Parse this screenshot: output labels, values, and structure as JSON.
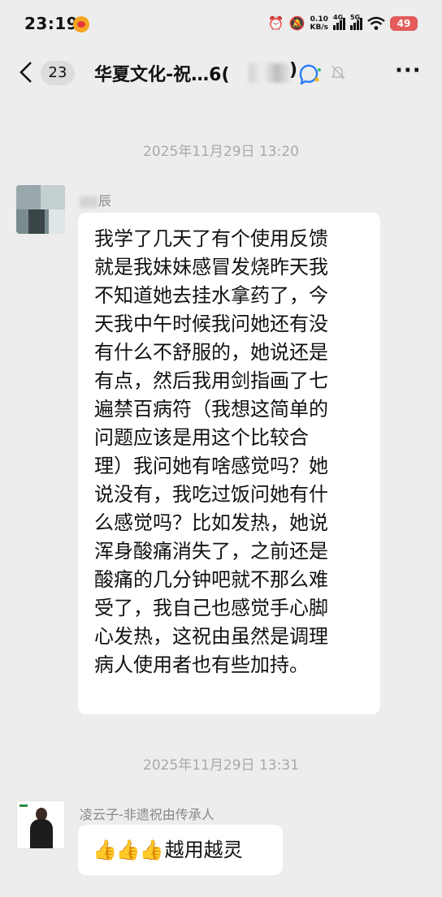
{
  "status_bar": {
    "time": "23:19",
    "net_speed_value": "0.10",
    "net_speed_unit": "KB/s",
    "signal_1_tag": "4G",
    "signal_2_tag": "5G",
    "battery": "49",
    "icons": [
      "weibo-icon",
      "alarm-icon",
      "mute-icon",
      "wifi-icon",
      "battery-icon"
    ]
  },
  "title_bar": {
    "back_icon": "chevron-left-icon",
    "unread_count": "23",
    "title": "华夏文化-祝…6(",
    "title_tail": ")",
    "icons": [
      "ai-assistant-icon",
      "bell-muted-icon",
      "more-icon"
    ],
    "more": "···"
  },
  "messages": [
    {
      "timestamp": "2025年11月29日 13:20",
      "sender": "辰",
      "lines": [
        "我学了几天了有个使用反馈",
        "就是我妹妹感冒发烧昨天我",
        "不知道她去挂水拿药了，今",
        "天我中午时候我问她还有没",
        "有什么不舒服的，她说还是",
        "有点，然后我用剑指画了七",
        "遍禁百病符（我想这简单的",
        "问题应该是用这个比较合",
        "理）我问她有啥感觉吗？她",
        "说没有，我吃过饭问她有什",
        "么感觉吗？比如发热，她说",
        "浑身酸痛消失了，之前还是",
        "酸痛的几分钟吧就不那么难",
        "受了，我自己也感觉手心脚",
        "心发热，这祝由虽然是调理",
        "病人使用者也有些加持。"
      ]
    },
    {
      "timestamp": "2025年11月29日 13:31",
      "sender": "凌云子-非遗祝由传承人",
      "emoji": "👍👍👍",
      "text": "越用越灵"
    }
  ],
  "colors": {
    "background": "#ededed",
    "bubble": "#ffffff",
    "timestamp": "#a9a9a9",
    "battery": "#e35b5b"
  }
}
